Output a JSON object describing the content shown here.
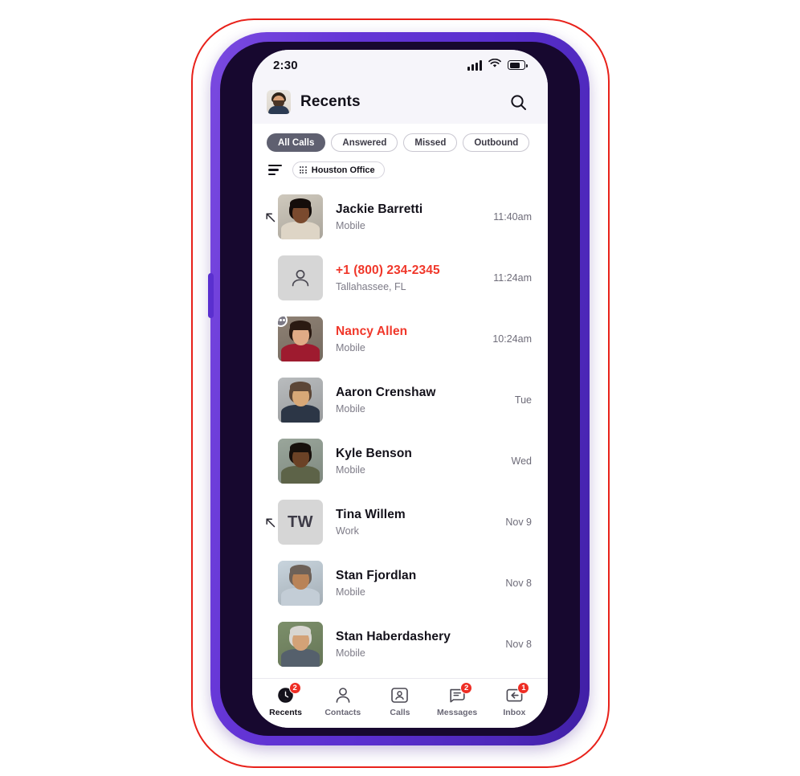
{
  "device": {
    "case_color": "#5a2fcf",
    "annotation_outline_color": "#e8211a"
  },
  "status_bar": {
    "time": "2:30",
    "signal_icon": "cellular-signal-icon",
    "wifi_icon": "wifi-icon",
    "battery_icon": "battery-icon"
  },
  "header": {
    "avatar_name": "user-avatar",
    "title": "Recents",
    "search_icon": "search-icon"
  },
  "filters": {
    "chips": [
      {
        "label": "All Calls",
        "active": true
      },
      {
        "label": "Answered",
        "active": false
      },
      {
        "label": "Missed",
        "active": false
      },
      {
        "label": "Outbound",
        "active": false
      }
    ],
    "sort_icon": "sort-icon",
    "location_chip": {
      "label": "Houston Office",
      "icon": "dot-grid-icon"
    }
  },
  "calls": [
    {
      "name": "Jackie Barretti",
      "sub": "Mobile",
      "time": "11:40am",
      "missed": false,
      "outbound": true,
      "voicemail": false,
      "avatar_type": "photo",
      "initials": "",
      "skin": "#7a4a2e",
      "hair": "#140d0a",
      "cloth": "#ded5c6",
      "bg": "#cfc9bd"
    },
    {
      "name": "+1 (800) 234-2345",
      "sub": "Tallahassee, FL",
      "time": "11:24am",
      "missed": true,
      "outbound": false,
      "voicemail": false,
      "avatar_type": "placeholder",
      "initials": "",
      "skin": "",
      "hair": "",
      "cloth": "",
      "bg": "#d6d6d6"
    },
    {
      "name": "Nancy Allen",
      "sub": "Mobile",
      "time": "10:24am",
      "missed": true,
      "outbound": false,
      "voicemail": true,
      "avatar_type": "photo",
      "initials": "",
      "skin": "#e0ab86",
      "hair": "#2a1a12",
      "cloth": "#9e1b2f",
      "bg": "#8e8174"
    },
    {
      "name": "Aaron Crenshaw",
      "sub": "Mobile",
      "time": "Tue",
      "missed": false,
      "outbound": false,
      "voicemail": false,
      "avatar_type": "photo",
      "initials": "",
      "skin": "#d8a877",
      "hair": "#5c4636",
      "cloth": "#2c3646",
      "bg": "#b9bcbe"
    },
    {
      "name": "Kyle Benson",
      "sub": "Mobile",
      "time": "Wed",
      "missed": false,
      "outbound": false,
      "voicemail": false,
      "avatar_type": "photo",
      "initials": "",
      "skin": "#6b4226",
      "hair": "#17100c",
      "cloth": "#5d6348",
      "bg": "#9aa69b"
    },
    {
      "name": "Tina Willem",
      "sub": "Work",
      "time": "Nov 9",
      "missed": false,
      "outbound": true,
      "voicemail": false,
      "avatar_type": "initials",
      "initials": "TW",
      "skin": "",
      "hair": "",
      "cloth": "",
      "bg": "#d6d6d6"
    },
    {
      "name": "Stan Fjordlan",
      "sub": "Mobile",
      "time": "Nov 8",
      "missed": false,
      "outbound": false,
      "voicemail": false,
      "avatar_type": "photo",
      "initials": "",
      "skin": "#b98357",
      "hair": "#6d6158",
      "cloth": "#c3cdd6",
      "bg": "#c8d4dd"
    },
    {
      "name": "Stan Haberdashery",
      "sub": "Mobile",
      "time": "Nov 8",
      "missed": false,
      "outbound": false,
      "voicemail": false,
      "avatar_type": "photo",
      "initials": "",
      "skin": "#d3a277",
      "hair": "#d8d6d1",
      "cloth": "#55606c",
      "bg": "#7c8f6a"
    }
  ],
  "tabbar": [
    {
      "label": "Recents",
      "icon": "recents-clock-icon",
      "badge": "2",
      "active": true
    },
    {
      "label": "Contacts",
      "icon": "contacts-person-icon",
      "badge": "",
      "active": false
    },
    {
      "label": "Calls",
      "icon": "calls-card-icon",
      "badge": "",
      "active": false
    },
    {
      "label": "Messages",
      "icon": "messages-document-icon",
      "badge": "2",
      "active": false
    },
    {
      "label": "Inbox",
      "icon": "inbox-tray-icon",
      "badge": "1",
      "active": false
    }
  ]
}
